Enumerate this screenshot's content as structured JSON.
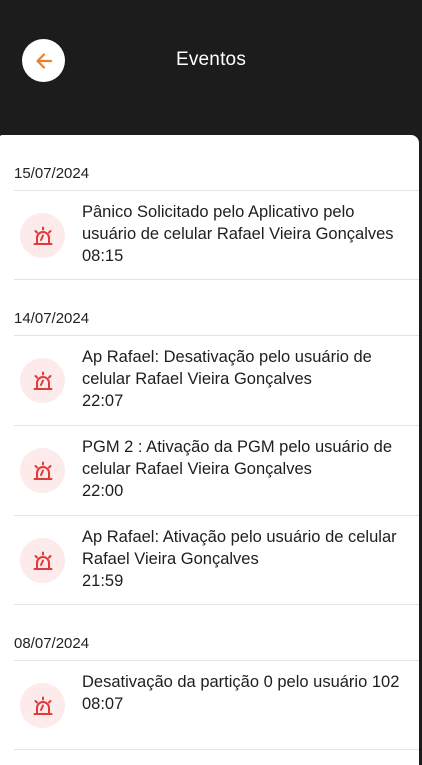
{
  "header": {
    "title": "Eventos"
  },
  "groups": [
    {
      "date": "15/07/2024",
      "events": [
        {
          "description": "Pânico Solicitado pelo Aplicativo pelo usuário de celular Rafael Vieira Gonçalves",
          "time": "08:15"
        }
      ]
    },
    {
      "date": "14/07/2024",
      "events": [
        {
          "description": "Ap Rafael: Desativação pelo usuário de celular Rafael Vieira Gonçalves",
          "time": "22:07"
        },
        {
          "description": "PGM 2 : Ativação da PGM pelo usuário de celular Rafael Vieira Gonçalves",
          "time": "22:00"
        },
        {
          "description": "Ap Rafael: Ativação pelo usuário de celular Rafael Vieira Gonçalves",
          "time": "21:59"
        }
      ]
    },
    {
      "date": "08/07/2024",
      "events": [
        {
          "description": "Desativação da partição 0 pelo usuário 102",
          "time": "08:07"
        }
      ]
    }
  ],
  "colors": {
    "accent": "#e8812d",
    "alarm": "#e03a3a",
    "alarm_bg": "#fdeaea"
  },
  "icons": {
    "back": "arrow-left-icon",
    "event": "alarm-siren-icon"
  }
}
